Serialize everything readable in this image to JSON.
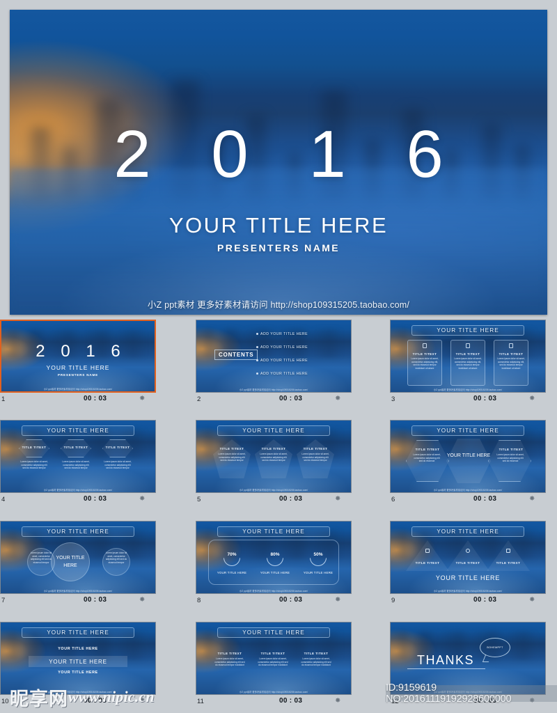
{
  "hero": {
    "year": "2 0 1 6",
    "title": "YOUR TITLE HERE",
    "presenter": "PRESENTERS NAME",
    "shop_line": "小Z ppt素材 更多好素材请访问 http://shop109315205.taobao.com/"
  },
  "common": {
    "title_bar": "YOUR TITLE HERE",
    "footer": "小Z ppt素材 更多好素材请访问 http://shop109315205.taobao.com/",
    "lorem": "Lorem ipsum dolor sit amet, consectetur adipisicing elit, sed do eiusmod tempor incididunt ut labore et dolore magna aliqua.",
    "title_text": "TITLE TITEXT",
    "duration": "00 : 03",
    "star_glyph": "✸"
  },
  "thumbnails": [
    {
      "num": "1",
      "duration": "00 : 03",
      "selected": true,
      "kind": "cover",
      "year": "2 0 1 6",
      "title": "YOUR TITLE HERE",
      "presenter": "PRESENTERS NAME"
    },
    {
      "num": "2",
      "duration": "00 : 03",
      "selected": false,
      "kind": "contents",
      "label": "CONTENTS",
      "items": [
        "ADD YOUR TITLE HERE",
        "ADD YOUR TITLE HERE",
        "ADD YOUR TITLE HERE",
        "ADD YOUR TITLE HERE"
      ]
    },
    {
      "num": "3",
      "duration": "00 : 03",
      "selected": false,
      "kind": "cards-icons",
      "title": "YOUR TITLE HERE",
      "icons": [
        "phone-icon",
        "mail-icon",
        "monitor-icon"
      ],
      "cards": [
        {
          "title": "TITLE TITEXT",
          "body": "Lorem ipsum dolor sit amet, consectetur adipisicing elit, sed do eiusmod tempor incididunt ut labore"
        },
        {
          "title": "TITLE TITEXT",
          "body": "Lorem ipsum dolor sit amet, consectetur adipisicing elit, sed do eiusmod tempor incididunt ut labore"
        },
        {
          "title": "TITLE TITEXT",
          "body": "Lorem ipsum dolor sit amet, consectetur adipisicing elit, sed do eiusmod tempor incididunt ut labore"
        }
      ]
    },
    {
      "num": "4",
      "duration": "00 : 03",
      "selected": false,
      "kind": "hex-row",
      "title": "YOUR TITLE HERE",
      "cards": [
        {
          "title": "TITLE TITEXT",
          "body": "Lorem ipsum dolor sit amet, consectetur adipisicing elit sed do eiusmod tempor"
        },
        {
          "title": "TITLE TITEXT",
          "body": "Lorem ipsum dolor sit amet, consectetur adipisicing elit sed do eiusmod tempor"
        },
        {
          "title": "TITLE TITEXT",
          "body": "Lorem ipsum dolor sit amet, consectetur adipisicing elit sed do eiusmod tempor"
        }
      ]
    },
    {
      "num": "5",
      "duration": "00 : 03",
      "selected": false,
      "kind": "pentagons",
      "title": "YOUR TITLE HERE",
      "cards": [
        {
          "title": "TITLE TITEXT",
          "body": "Lorem ipsum dolor sit amet, consectetur adipisicing elit sed do eiusmod tempor"
        },
        {
          "title": "TITLE TITEXT",
          "body": "Lorem ipsum dolor sit amet, consectetur adipisicing elit sed do eiusmod tempor"
        },
        {
          "title": "TITLE TITEXT",
          "body": "Lorem ipsum dolor sit amet, consectetur adipisicing elit sed do eiusmod tempor"
        }
      ]
    },
    {
      "num": "6",
      "duration": "00 : 03",
      "selected": false,
      "kind": "hex-center",
      "title": "YOUR TITLE HERE",
      "center": "YOUR TITLE HERE",
      "cards": [
        {
          "title": "TITLE TITEXT",
          "body": "Lorem ipsum dolor sit amet, consectetur adipisicing elit sed do eiusmod"
        },
        {
          "title": "TITLE TITEXT",
          "body": "Lorem ipsum dolor sit amet, consectetur adipisicing elit sed do eiusmod"
        }
      ]
    },
    {
      "num": "7",
      "duration": "00 : 03",
      "selected": false,
      "kind": "circles",
      "title": "YOUR TITLE HERE",
      "center": "YOUR TITLE HERE",
      "cards": [
        {
          "body": "Lorem ipsum dolor sit amet, consectetur adipisicing elit sed do eiusmod tempor"
        },
        {
          "body": "Lorem ipsum dolor sit amet, consectetur adipisicing elit sed do eiusmod tempor"
        }
      ]
    },
    {
      "num": "8",
      "duration": "00 : 03",
      "selected": false,
      "kind": "percent",
      "title": "YOUR TITLE HERE",
      "stats": [
        {
          "value": "70%",
          "label": "YOUR TITLE HERE"
        },
        {
          "value": "80%",
          "label": "YOUR TITLE HERE"
        },
        {
          "value": "50%",
          "label": "YOUR TITLE HERE"
        }
      ]
    },
    {
      "num": "9",
      "duration": "00 : 03",
      "selected": false,
      "kind": "triangles",
      "title": "YOUR TITLE HERE",
      "bottom": "YOUR TITLE HERE",
      "icons": [
        "pencil-icon",
        "clock-icon",
        "hourglass-icon"
      ],
      "cards": [
        {
          "title": "TITLE TITEXT"
        },
        {
          "title": "TITLE TITEXT"
        },
        {
          "title": "TITLE TITEXT"
        }
      ]
    },
    {
      "num": "10",
      "duration": "00 : 03",
      "selected": false,
      "kind": "stack",
      "title": "YOUR TITLE HERE",
      "rows": [
        "YOUR TITLE HERE",
        "YOUR TITLE HERE",
        "YOUR TITLE HERE"
      ]
    },
    {
      "num": "11",
      "duration": "00 : 03",
      "selected": false,
      "kind": "columns",
      "title": "YOUR TITLE HERE",
      "cards": [
        {
          "title": "TITLE TITEXT",
          "body": "Lorem ipsum dolor sit amet, consectetur adipisicing elit sed do eiusmod tempor incididunt"
        },
        {
          "title": "TITLE TITEXT",
          "body": "Lorem ipsum dolor sit amet, consectetur adipisicing elit sed do eiusmod tempor incididunt"
        },
        {
          "title": "TITLE TITEXT",
          "body": "Lorem ipsum dolor sit amet, consectetur adipisicing elit sed do eiusmod tempor incididunt"
        }
      ]
    },
    {
      "num": "12",
      "duration": "00 : 03",
      "selected": false,
      "kind": "thanks",
      "thanks": "THANKS",
      "bubble": "BOHEMPPT"
    }
  ],
  "watermark": {
    "cn": "昵享网",
    "url": "www.nipic.cn"
  },
  "id_strip": "ID:9159619 NO:20161119192928600000",
  "colors": {
    "page_bg": "#c8cdd2",
    "selection": "#e2601e",
    "slide_blue": "#1d5697",
    "slide_sun": "#e4963c",
    "text_white": "#ffffff"
  }
}
